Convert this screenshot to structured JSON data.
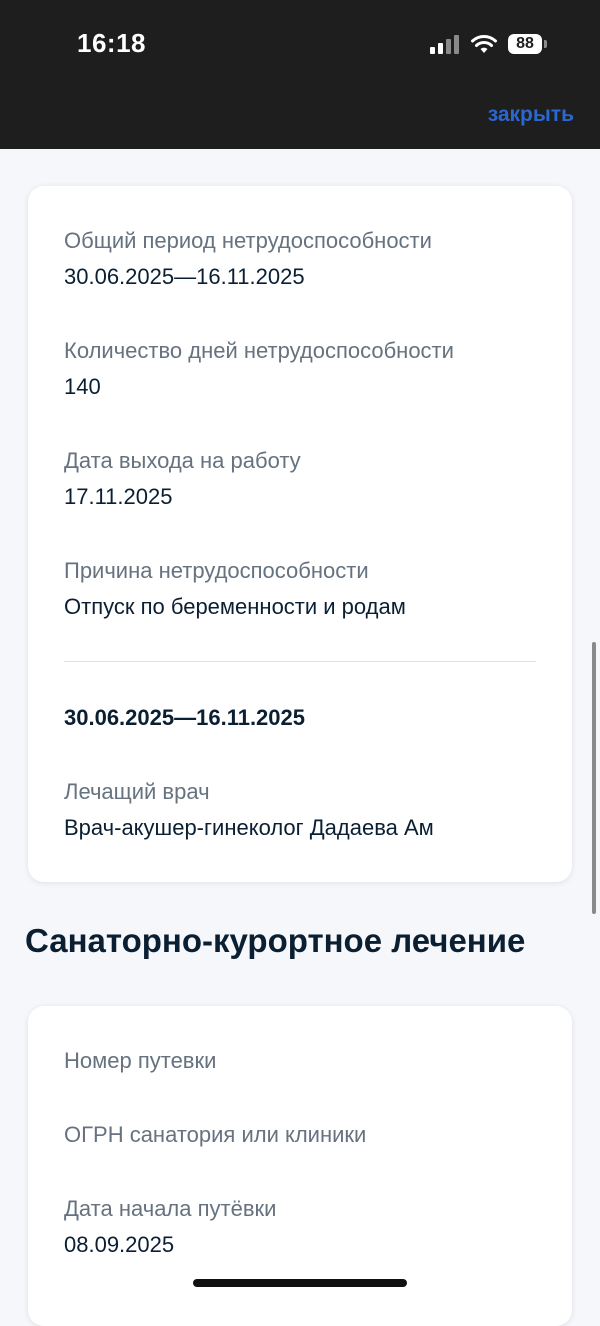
{
  "status_bar": {
    "time": "16:18",
    "battery": "88"
  },
  "header": {
    "close_label": "закрыть",
    "accent_color": "#2b67d1"
  },
  "incapacity_card": {
    "fields": [
      {
        "label": "Общий период нетрудоспособности",
        "value": "30.06.2025—16.11.2025"
      },
      {
        "label": "Количество дней нетрудоспособности",
        "value": "140"
      },
      {
        "label": "Дата выхода на работу",
        "value": "17.11.2025"
      },
      {
        "label": "Причина нетрудоспособности",
        "value": "Отпуск по беременности и родам"
      }
    ],
    "period": {
      "range": "30.06.2025—16.11.2025",
      "doctor_label": "Лечащий врач",
      "doctor_value": "Врач-акушер-гинеколог Дадаева Ам"
    }
  },
  "sanatorium": {
    "title": "Санаторно-курортное лечение",
    "fields": [
      {
        "label": "Номер путевки",
        "value": ""
      },
      {
        "label": "ОГРН санатория или клиники",
        "value": ""
      },
      {
        "label": "Дата начала путёвки",
        "value": "08.09.2025"
      }
    ]
  }
}
